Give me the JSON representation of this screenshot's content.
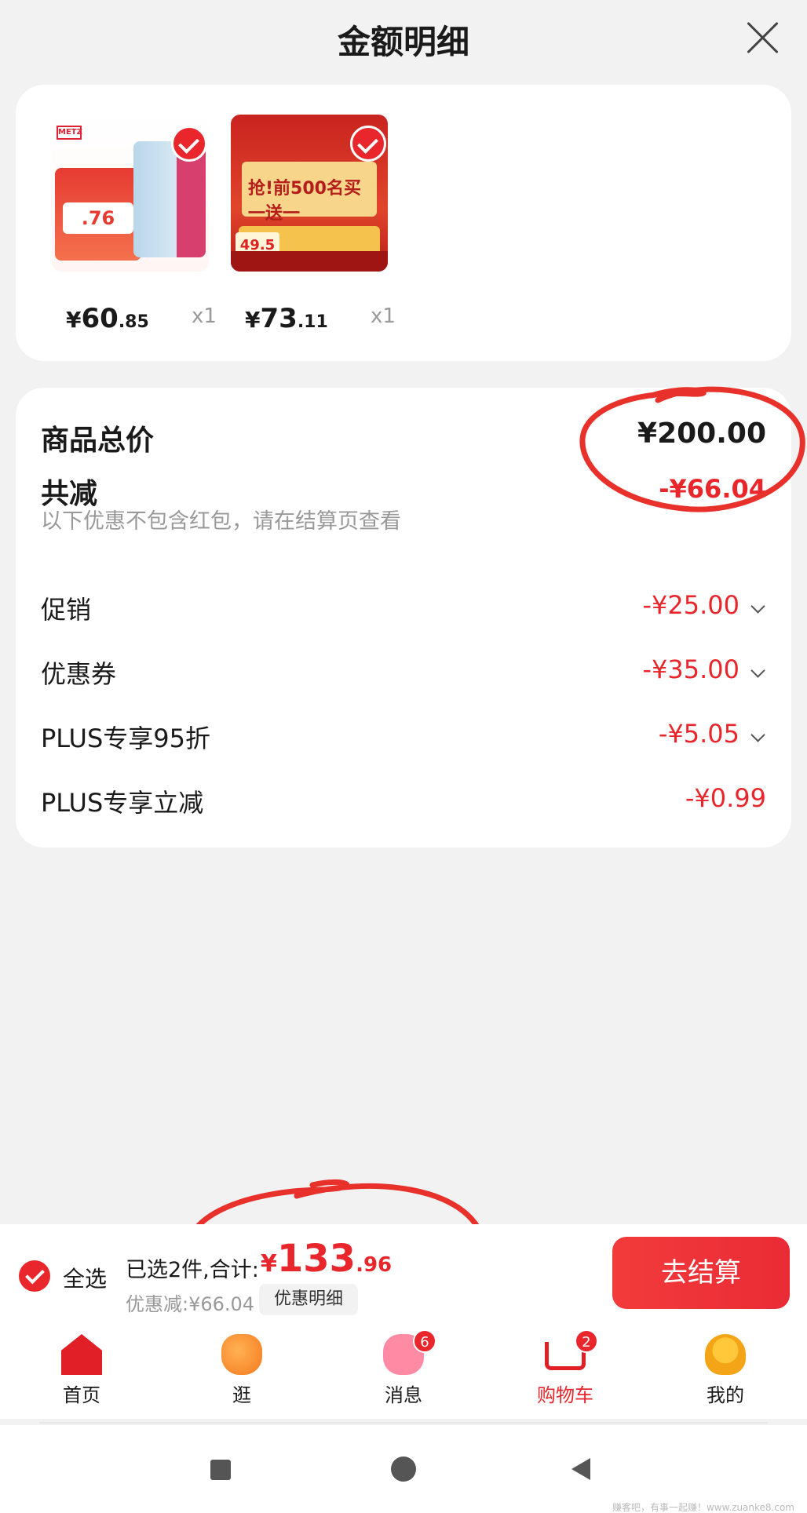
{
  "header": {
    "title": "金额明细"
  },
  "products": [
    {
      "price_symbol": "¥",
      "price_int": "60",
      "price_dec": ".85",
      "qty": "x1",
      "logo": "METZ",
      "promo": ".76"
    },
    {
      "price_symbol": "¥",
      "price_int": "73",
      "price_dec": ".11",
      "qty": "x1",
      "headline": "抢!前500名买一送一",
      "tag": "49.5"
    }
  ],
  "summary": {
    "total_label": "商品总价",
    "total_value": "¥200.00",
    "reduce_label": "共减",
    "reduce_value": "-¥66.04",
    "hint": "以下优惠不包含红包，请在结算页查看",
    "discounts": [
      {
        "label": "促销",
        "value": "-¥25.00"
      },
      {
        "label": "优惠券",
        "value": "-¥35.00"
      },
      {
        "label": "PLUS专享95折",
        "value": "-¥5.05"
      },
      {
        "label": "PLUS专享立减",
        "value": "-¥0.99"
      }
    ]
  },
  "bottom_bar": {
    "select_all": "全选",
    "selected_summary": "已选2件,合计:",
    "total_symbol": "¥",
    "total_int": "133",
    "total_dec": ".96",
    "saved": "优惠减:¥66.04",
    "detail_button": "优惠明细",
    "checkout_button": "去结算"
  },
  "tab_bar": {
    "items": [
      {
        "label": "首页",
        "icon": "home-icon"
      },
      {
        "label": "逛",
        "icon": "browse-icon"
      },
      {
        "label": "消息",
        "icon": "message-icon",
        "badge": "6"
      },
      {
        "label": "购物车",
        "icon": "cart-icon",
        "badge": "2",
        "active": true
      },
      {
        "label": "我的",
        "icon": "profile-icon"
      }
    ]
  },
  "watermark": "赚客吧，有事一起赚！www.zuanke8.com",
  "colors": {
    "accent": "#e8262b",
    "annotation": "#e8312a"
  }
}
